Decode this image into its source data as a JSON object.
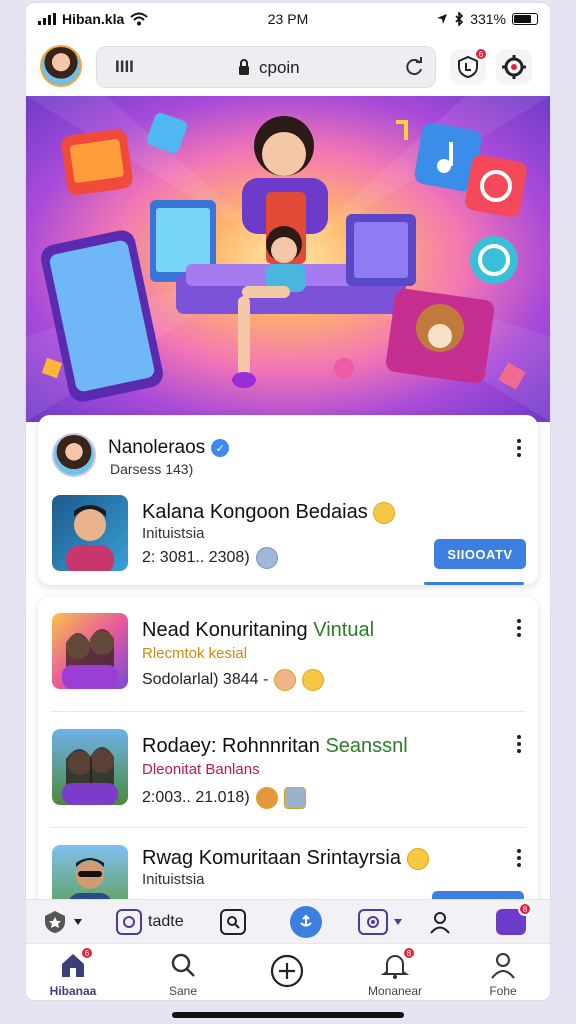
{
  "status_bar": {
    "carrier": "Hiban.kla",
    "time": "23 PM",
    "battery": "331%"
  },
  "top_bar": {
    "tabs_glyph": "IIII",
    "url": "cpoin",
    "notif_badge": "6"
  },
  "feed_card": {
    "author_name": "Nanoleraos",
    "author_sub": "Darsess 143)",
    "title": "Kalana Kongoon Bedaias",
    "subtitle": "Inituistsia",
    "meta": "2: 3081.. 2308)",
    "join_label": "SIIOOATV"
  },
  "list_items": [
    {
      "title": "Nead Konuritaning ",
      "title_accent": "Vintual",
      "subtitle": "Rlecmtok kesial",
      "subtitle_color": "#c98a10",
      "meta": "Sodolarlal)  3844 -"
    },
    {
      "title": "Rodaey: Rohnnritan ",
      "title_accent": "Seanssnl",
      "subtitle": "Dleonitat Banlans",
      "subtitle_color": "#c2184b",
      "meta": "2:003.. 21.018)"
    },
    {
      "title": "Rwag Komuritaan Srintayrsia",
      "title_accent": "",
      "subtitle": "Inituistsia",
      "subtitle_color": "#333333",
      "meta": ""
    }
  ],
  "toolbar": {
    "text_label": "tadte",
    "badge": "8"
  },
  "bottom_nav": [
    {
      "label": "Hibanaa",
      "icon": "home-icon",
      "badge": "6"
    },
    {
      "label": "Sane",
      "icon": "search-icon",
      "badge": ""
    },
    {
      "label": "",
      "icon": "plus-circle-icon",
      "badge": ""
    },
    {
      "label": "Monanear",
      "icon": "bell-icon",
      "badge": "8"
    },
    {
      "label": "Fohe",
      "icon": "profile-icon",
      "badge": ""
    }
  ],
  "colors": {
    "accent": "#3d7fe0",
    "brand_purple": "#6d3bc9",
    "badge_red": "#e5213a"
  }
}
